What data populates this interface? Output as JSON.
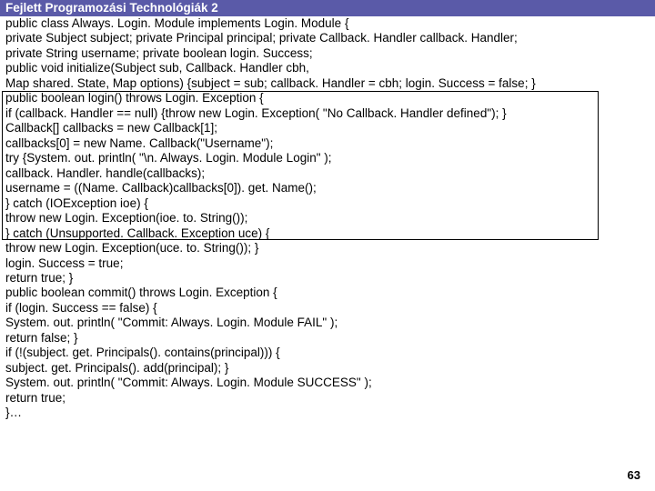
{
  "header": "Fejlett Programozási Technológiák 2",
  "page_number": "63",
  "lines": [
    "public class Always. Login. Module implements Login. Module {",
    "private Subject subject; private Principal principal; private Callback. Handler callback. Handler;",
    "private String username; private boolean login. Success;",
    "public void initialize(Subject sub, Callback. Handler cbh,",
    "Map shared. State, Map options) {subject = sub; callback. Handler = cbh; login. Success = false; }",
    "public boolean login() throws Login. Exception {",
    "if (callback. Handler == null) {throw new Login. Exception( \"No Callback. Handler defined\"); }",
    "Callback[] callbacks = new Callback[1];",
    "callbacks[0] = new Name. Callback(\"Username\");",
    "try {System. out. println( \"\\n. Always. Login. Module Login\" );",
    "callback. Handler. handle(callbacks);",
    "username = ((Name. Callback)callbacks[0]). get. Name();",
    "} catch (IOException ioe) {",
    "throw new Login. Exception(ioe. to. String());",
    "} catch (Unsupported. Callback. Exception uce) {",
    "throw new Login. Exception(uce. to. String()); }",
    "login. Success = true;",
    "return true; }",
    "public boolean commit() throws Login. Exception {",
    "if (login. Success == false) {",
    "System. out. println( \"Commit: Always. Login. Module FAIL\" );",
    "return false; }",
    "if (!(subject. get. Principals(). contains(principal))) {",
    "subject. get. Principals(). add(principal); }",
    "System. out. println( \"Commit: Always. Login. Module SUCCESS\" );",
    "return true;",
    "}…"
  ]
}
